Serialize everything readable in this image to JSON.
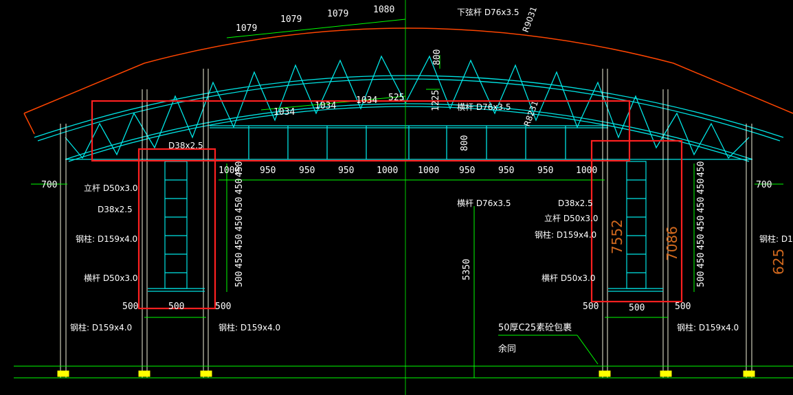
{
  "drawing": {
    "top_dims": [
      "1079",
      "1079",
      "1079",
      "1080"
    ],
    "radius_top": "R9031",
    "top_member": "下弦杆 D76x3.5",
    "truss_depth": "800",
    "inner_dims": [
      "1034",
      "1034",
      "1034",
      "525"
    ],
    "rise_1225": "1225",
    "radius_inner": "R8231",
    "beam_top": "横杆 D76x3.5",
    "beam_mid": "横杆 D76x3.5",
    "depth_800": "800",
    "d38_label": "D38x2.5",
    "bay_dims": [
      "1000",
      "950",
      "950",
      "950",
      "1000",
      "1000",
      "950",
      "950",
      "950",
      "1000"
    ],
    "v_dims_left": [
      "450",
      "450",
      "450",
      "450",
      "450",
      "450",
      "500"
    ],
    "v_dims_right": [
      "450",
      "450",
      "450",
      "450",
      "450",
      "450",
      "500"
    ],
    "h_700": "700",
    "h_500": "500",
    "height_5350": "5350",
    "left_labels": {
      "vertical": "立杆 D50x3.0",
      "diag": "D38x2.5",
      "column": "钢柱: D159x4.0",
      "horizontal": "横杆 D50x3.0"
    },
    "right_labels": {
      "diag": "D38x2.5",
      "vertical": "立杆 D50x3.0",
      "column": "钢柱: D159x4.0",
      "horizontal": "横杆 D50x3.0"
    },
    "col_bottom_label": "钢柱: D159x4.0",
    "far_right_label": "钢柱: D1",
    "note_1": "50厚C25素砼包裹",
    "note_2": "余同",
    "orange_dims": [
      "7552",
      "7086",
      "625"
    ],
    "colors": {
      "bg": "#000000",
      "truss": "#00e5e5",
      "dim_line": "#00ff00",
      "highlight": "#ff2020",
      "roof": "#ff4500"
    }
  }
}
